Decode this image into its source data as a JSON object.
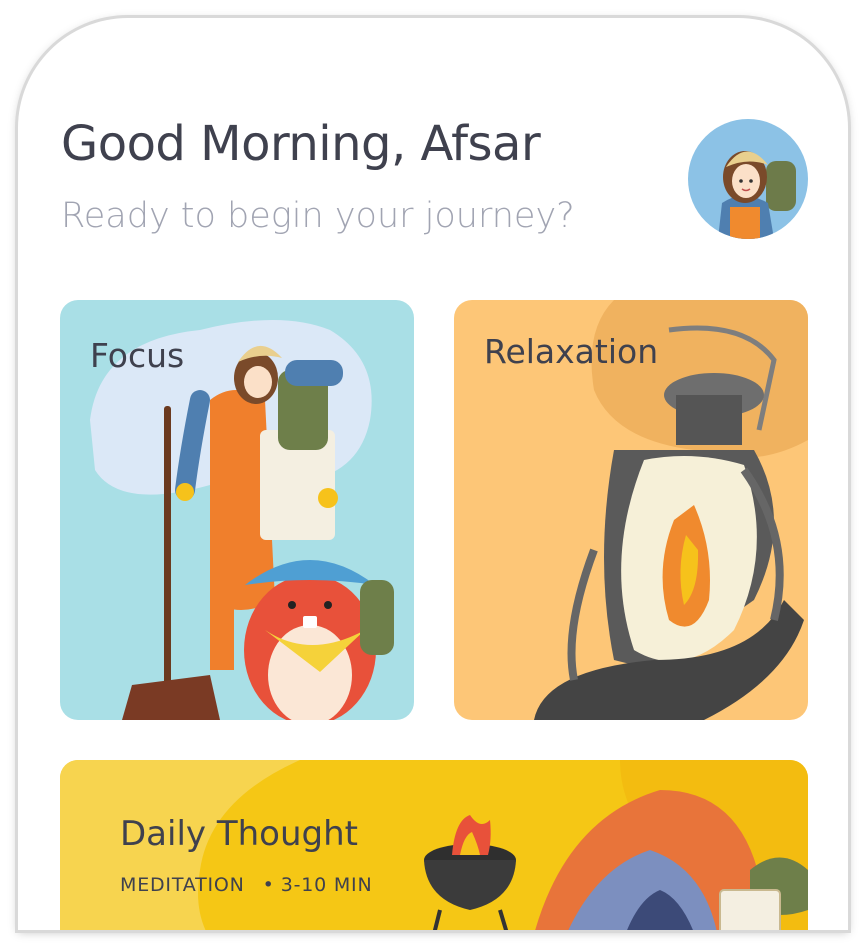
{
  "header": {
    "greeting": "Good Morning, Afsar",
    "subtitle": "Ready to begin your journey?"
  },
  "cards": {
    "focus": {
      "label": "Focus",
      "color": "#a9dfe6"
    },
    "relaxation": {
      "label": "Relaxation",
      "color": "#fdc677"
    }
  },
  "daily": {
    "title": "Daily Thought",
    "category": "MEDITATION",
    "duration": "3-10 MIN",
    "color": "#f5c715"
  }
}
